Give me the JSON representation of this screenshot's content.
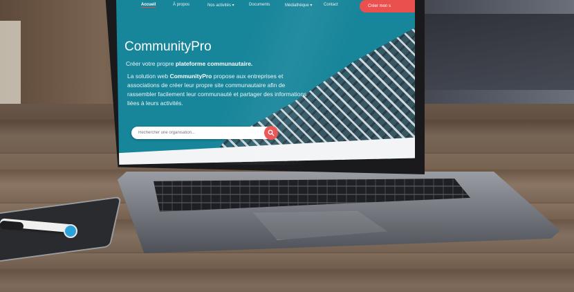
{
  "nav": {
    "items": [
      "Accueil",
      "À propos",
      "Nos activités ▾",
      "Documents",
      "Médiathèque ▾",
      "Contact"
    ],
    "cta_label": "Créer mon s"
  },
  "hero": {
    "title": "CommunityPro",
    "subtitle_prefix": "Créer votre propre ",
    "subtitle_bold": "plateforme communautaire.",
    "body_prefix": "La solution web ",
    "body_bold": "CommunityPro",
    "body_rest": " propose aux entreprises et associations de créer leur propre site communautaire afin de rassembler facilement leur communauté et partager des informations liées à leurs activités."
  },
  "search": {
    "placeholder": "Rechercher une organisation..."
  },
  "colors": {
    "brand_teal": "#17859a",
    "accent_red": "#e9504e"
  },
  "icons": {
    "search": "search-icon"
  }
}
